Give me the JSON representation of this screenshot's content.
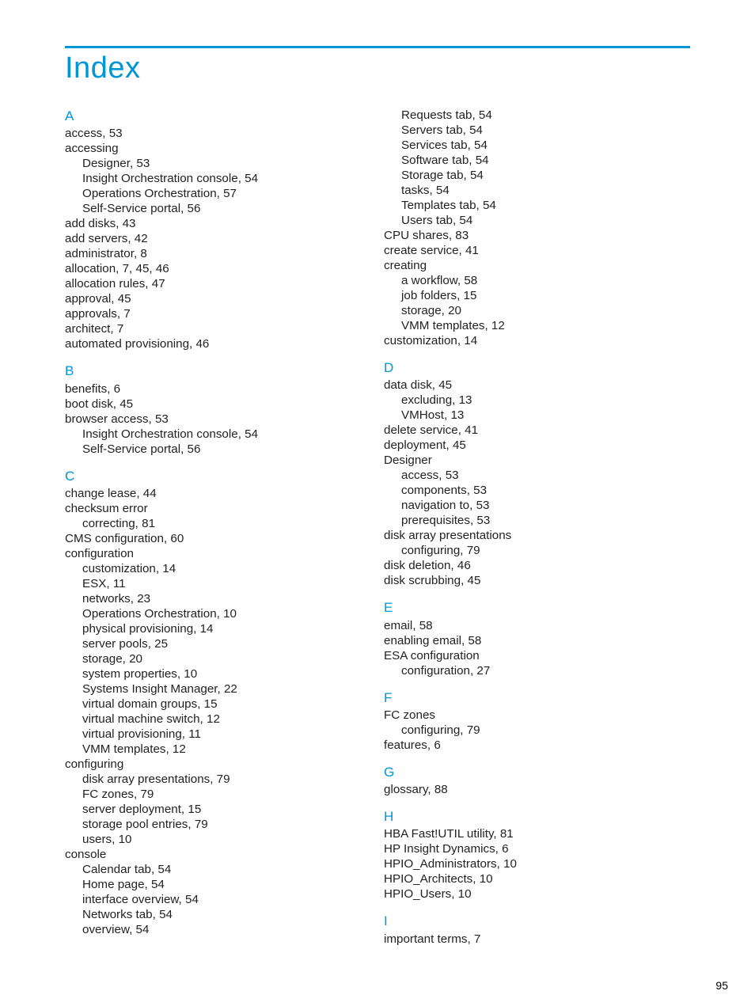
{
  "title": "Index",
  "page_number": "95",
  "left": [
    {
      "type": "letter",
      "text": "A",
      "first": true
    },
    {
      "lv": 0,
      "text": "access, 53"
    },
    {
      "lv": 0,
      "text": "accessing"
    },
    {
      "lv": 1,
      "text": "Designer, 53"
    },
    {
      "lv": 1,
      "text": "Insight Orchestration console, 54"
    },
    {
      "lv": 1,
      "text": "Operations Orchestration, 57"
    },
    {
      "lv": 1,
      "text": "Self-Service portal, 56"
    },
    {
      "lv": 0,
      "text": "add disks, 43"
    },
    {
      "lv": 0,
      "text": "add servers, 42"
    },
    {
      "lv": 0,
      "text": "administrator, 8"
    },
    {
      "lv": 0,
      "text": "allocation, 7, 45, 46"
    },
    {
      "lv": 0,
      "text": "allocation rules, 47"
    },
    {
      "lv": 0,
      "text": "approval, 45"
    },
    {
      "lv": 0,
      "text": "approvals, 7"
    },
    {
      "lv": 0,
      "text": "architect, 7"
    },
    {
      "lv": 0,
      "text": "automated provisioning, 46"
    },
    {
      "type": "letter",
      "text": "B"
    },
    {
      "lv": 0,
      "text": "benefits, 6"
    },
    {
      "lv": 0,
      "text": "boot disk, 45"
    },
    {
      "lv": 0,
      "text": "browser access, 53"
    },
    {
      "lv": 1,
      "text": "Insight Orchestration console, 54"
    },
    {
      "lv": 1,
      "text": "Self-Service portal, 56"
    },
    {
      "type": "letter",
      "text": "C"
    },
    {
      "lv": 0,
      "text": "change lease, 44"
    },
    {
      "lv": 0,
      "text": "checksum error"
    },
    {
      "lv": 1,
      "text": "correcting, 81"
    },
    {
      "lv": 0,
      "text": "CMS configuration, 60"
    },
    {
      "lv": 0,
      "text": "configuration"
    },
    {
      "lv": 1,
      "text": "customization, 14"
    },
    {
      "lv": 1,
      "text": "ESX, 11"
    },
    {
      "lv": 1,
      "text": "networks, 23"
    },
    {
      "lv": 1,
      "text": "Operations Orchestration, 10"
    },
    {
      "lv": 1,
      "text": "physical provisioning, 14"
    },
    {
      "lv": 1,
      "text": "server pools, 25"
    },
    {
      "lv": 1,
      "text": "storage, 20"
    },
    {
      "lv": 1,
      "text": "system properties, 10"
    },
    {
      "lv": 1,
      "text": "Systems Insight Manager, 22"
    },
    {
      "lv": 1,
      "text": "virtual domain groups, 15"
    },
    {
      "lv": 1,
      "text": "virtual machine switch, 12"
    },
    {
      "lv": 1,
      "text": "virtual provisioning, 11"
    },
    {
      "lv": 1,
      "text": "VMM templates, 12"
    },
    {
      "lv": 0,
      "text": "configuring"
    },
    {
      "lv": 1,
      "text": "disk array presentations, 79"
    },
    {
      "lv": 1,
      "text": "FC zones, 79"
    },
    {
      "lv": 1,
      "text": "server deployment, 15"
    },
    {
      "lv": 1,
      "text": "storage pool entries, 79"
    },
    {
      "lv": 1,
      "text": "users, 10"
    },
    {
      "lv": 0,
      "text": "console"
    },
    {
      "lv": 1,
      "text": "Calendar tab, 54"
    },
    {
      "lv": 1,
      "text": "Home page, 54"
    },
    {
      "lv": 1,
      "text": "interface overview, 54"
    },
    {
      "lv": 1,
      "text": "Networks tab, 54"
    },
    {
      "lv": 1,
      "text": "overview, 54"
    }
  ],
  "right": [
    {
      "lv": 1,
      "text": "Requests tab, 54"
    },
    {
      "lv": 1,
      "text": "Servers tab, 54"
    },
    {
      "lv": 1,
      "text": "Services tab, 54"
    },
    {
      "lv": 1,
      "text": "Software tab, 54"
    },
    {
      "lv": 1,
      "text": "Storage tab, 54"
    },
    {
      "lv": 1,
      "text": "tasks, 54"
    },
    {
      "lv": 1,
      "text": "Templates tab, 54"
    },
    {
      "lv": 1,
      "text": "Users tab, 54"
    },
    {
      "lv": 0,
      "text": "CPU shares, 83"
    },
    {
      "lv": 0,
      "text": "create service, 41"
    },
    {
      "lv": 0,
      "text": "creating"
    },
    {
      "lv": 1,
      "text": "a workflow, 58"
    },
    {
      "lv": 1,
      "text": "job folders, 15"
    },
    {
      "lv": 1,
      "text": "storage, 20"
    },
    {
      "lv": 1,
      "text": "VMM templates, 12"
    },
    {
      "lv": 0,
      "text": "customization, 14"
    },
    {
      "type": "letter",
      "text": "D"
    },
    {
      "lv": 0,
      "text": "data disk, 45"
    },
    {
      "lv": 1,
      "text": "excluding, 13"
    },
    {
      "lv": 1,
      "text": "VMHost, 13"
    },
    {
      "lv": 0,
      "text": "delete service, 41"
    },
    {
      "lv": 0,
      "text": "deployment, 45"
    },
    {
      "lv": 0,
      "text": "Designer"
    },
    {
      "lv": 1,
      "text": "access, 53"
    },
    {
      "lv": 1,
      "text": "components, 53"
    },
    {
      "lv": 1,
      "text": "navigation to, 53"
    },
    {
      "lv": 1,
      "text": "prerequisites, 53"
    },
    {
      "lv": 0,
      "text": "disk array presentations"
    },
    {
      "lv": 1,
      "text": "configuring, 79"
    },
    {
      "lv": 0,
      "text": "disk deletion, 46"
    },
    {
      "lv": 0,
      "text": "disk scrubbing, 45"
    },
    {
      "type": "letter",
      "text": "E"
    },
    {
      "lv": 0,
      "text": "email, 58"
    },
    {
      "lv": 0,
      "text": "enabling email, 58"
    },
    {
      "lv": 0,
      "text": "ESA configuration"
    },
    {
      "lv": 1,
      "text": "configuration, 27"
    },
    {
      "type": "letter",
      "text": "F"
    },
    {
      "lv": 0,
      "text": "FC zones"
    },
    {
      "lv": 1,
      "text": "configuring, 79"
    },
    {
      "lv": 0,
      "text": "features, 6"
    },
    {
      "type": "letter",
      "text": "G"
    },
    {
      "lv": 0,
      "text": "glossary, 88"
    },
    {
      "type": "letter",
      "text": "H"
    },
    {
      "lv": 0,
      "text": "HBA Fast!UTIL utility, 81"
    },
    {
      "lv": 0,
      "text": "HP Insight Dynamics, 6"
    },
    {
      "lv": 0,
      "text": "HPIO_Administrators, 10"
    },
    {
      "lv": 0,
      "text": "HPIO_Architects, 10"
    },
    {
      "lv": 0,
      "text": "HPIO_Users, 10"
    },
    {
      "type": "letter",
      "text": "I"
    },
    {
      "lv": 0,
      "text": "important terms, 7"
    }
  ]
}
